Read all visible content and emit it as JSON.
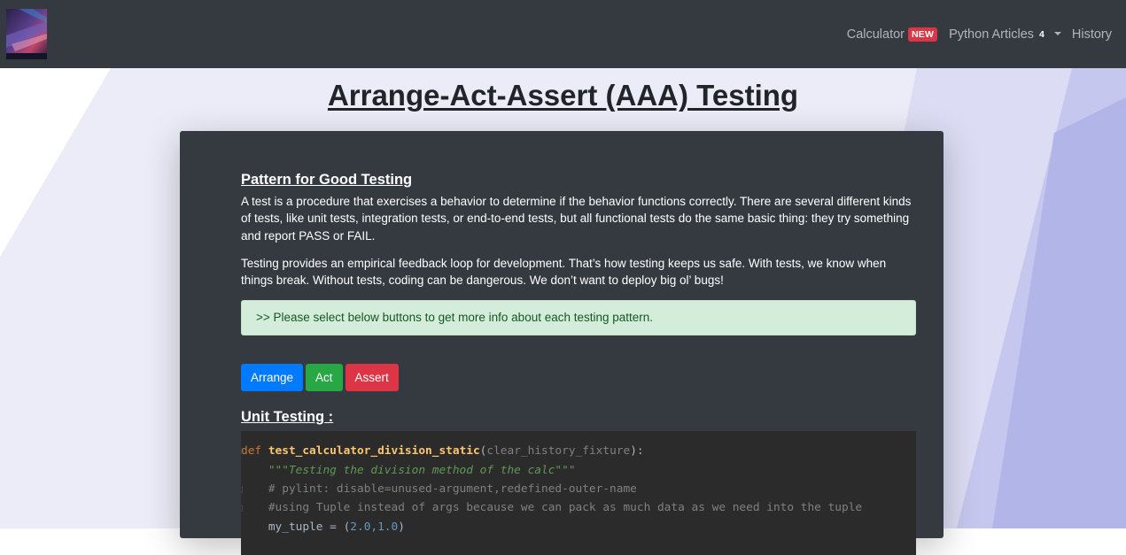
{
  "nav": {
    "logo_alt": "site logo",
    "calculator_label": "Calculator",
    "calculator_badge": "NEW",
    "articles_label": "Python Articles",
    "articles_count": "4",
    "history_label": "History"
  },
  "page": {
    "title": "Arrange-Act-Assert (AAA) Testing"
  },
  "card": {
    "section_title": "Pattern for Good Testing",
    "paragraph1": "A test is a procedure that exercises a behavior to determine if the behavior functions correctly. There are several different kinds of tests, like unit tests, integration tests, or end-to-end tests, but all functional tests do the same basic thing: they try something and report PASS or FAIL.",
    "paragraph2": "Testing provides an empirical feedback loop for development. That’s how testing keeps us safe. With tests, we know when things break. Without tests, coding can be dangerous. We don’t want to deploy big ol’ bugs!",
    "alert_text": ">> Please select below buttons to get more info about each testing pattern.",
    "buttons": {
      "arrange": "Arrange",
      "act": "Act",
      "assert": "Assert"
    },
    "unit_title": "Unit Testing :"
  },
  "code": {
    "line1_kw": "def ",
    "line1_fn": "test_calculator_division_static",
    "line1_open": "(",
    "line1_param": "clear_history_fixture",
    "line1_close": "):",
    "line2_doc": "\"\"\"Testing the division method of the calc\"\"\"",
    "line3_comment": "# pylint: disable=unused-argument,redefined-outer-name",
    "line4_comment": "#using Tuple instead of args because we can pack as much data as we need into the tuple",
    "line5_plain": "my_tuple = (",
    "line5_nums": "2.0,1.0",
    "line5_close": ")"
  },
  "colors": {
    "navbar": "#343a40",
    "card": "#343a40",
    "alert_bg": "#d4edda",
    "arrange": "#007bff",
    "act": "#28a745",
    "assert": "#dc3545",
    "badge": "#dc3545"
  },
  "icons": {
    "dropdown": "caret-down-icon"
  }
}
